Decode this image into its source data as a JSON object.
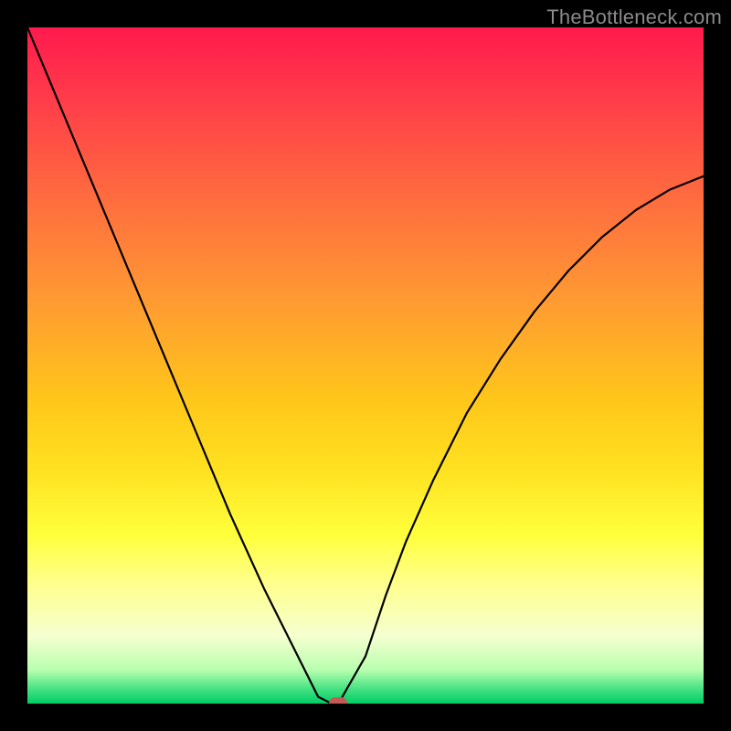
{
  "watermark": "TheBottleneck.com",
  "chart_data": {
    "type": "line",
    "title": "",
    "xlabel": "",
    "ylabel": "",
    "xlim": [
      0,
      100
    ],
    "ylim": [
      0,
      100
    ],
    "series": [
      {
        "name": "curve",
        "x": [
          0,
          5,
          10,
          15,
          20,
          25,
          30,
          35,
          40,
          43,
          45,
          46,
          50,
          53,
          56,
          60,
          65,
          70,
          75,
          80,
          85,
          90,
          95,
          100
        ],
        "y": [
          100,
          88,
          76,
          64,
          52,
          40,
          28,
          17,
          7,
          1,
          0,
          0,
          7,
          16,
          24,
          33,
          43,
          51,
          58,
          64,
          69,
          73,
          76,
          78
        ]
      }
    ],
    "marker": {
      "x": 46,
      "y": 0
    },
    "gradient_stops": [
      {
        "pos": 0,
        "color": "#ff1a4d"
      },
      {
        "pos": 25,
        "color": "#ff6b3f"
      },
      {
        "pos": 55,
        "color": "#ffc61a"
      },
      {
        "pos": 75,
        "color": "#ffff3b"
      },
      {
        "pos": 95,
        "color": "#b9ffb0"
      },
      {
        "pos": 100,
        "color": "#00cc66"
      }
    ]
  }
}
